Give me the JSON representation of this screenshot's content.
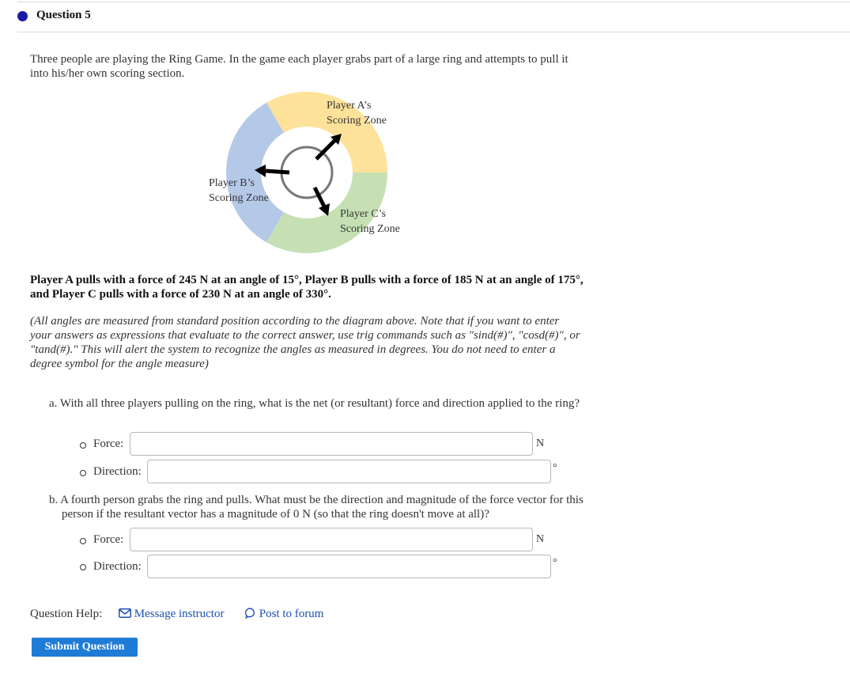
{
  "question": {
    "title": "Question 5"
  },
  "intro": "Three people are playing the Ring Game. In the game each player grabs part of a large ring and attempts to pull it into his/her own scoring section.",
  "diagram": {
    "zone_a_line1": "Player A’s",
    "zone_a_line2": "Scoring Zone",
    "zone_b_line1": "Player B’s",
    "zone_b_line2": "Scoring Zone",
    "zone_c_line1": "Player C’s",
    "zone_c_line2": "Scoring Zone",
    "colors": {
      "zone_a": "#ffe29a",
      "zone_b": "#b4c8e8",
      "zone_c": "#c6e0b4",
      "arrow": "#000000",
      "ring": "#777777"
    }
  },
  "problem": "Player A pulls with a force of 245 N at an angle of 15°, Player B pulls with a force of 185 N at an angle of 175°, and Player C pulls with a force of 230 N at an angle of 330°.",
  "note": "(All angles are measured from standard position according to the diagram above. Note that if you want to enter your answers as expressions that evaluate to the correct answer, use trig commands such as \"sind(#)\", \"cosd(#)\", or \"tand(#).\" This will alert the system to recognize the angles as measured in degrees. You do not need to enter a degree symbol for the angle measure)",
  "part_a": {
    "prompt": "a. With all three players pulling on the ring, what is the net (or resultant) force and direction applied to the ring?",
    "force_label": "Force:",
    "force_value": "",
    "force_unit": "N",
    "direction_label": "Direction:",
    "direction_value": "",
    "direction_unit": "°"
  },
  "part_b": {
    "prompt": "b. A fourth person grabs the ring and pulls. What must be the direction and magnitude of the force vector for this person if the resultant vector has a magnitude of 0 N (so that the ring doesn't move at all)?",
    "force_label": "Force:",
    "force_value": "",
    "force_unit": "N",
    "direction_label": "Direction:",
    "direction_value": "",
    "direction_unit": "°"
  },
  "help": {
    "label": "Question Help:",
    "message_label": "Message instructor",
    "forum_label": "Post to forum"
  },
  "submit_label": "Submit Question"
}
